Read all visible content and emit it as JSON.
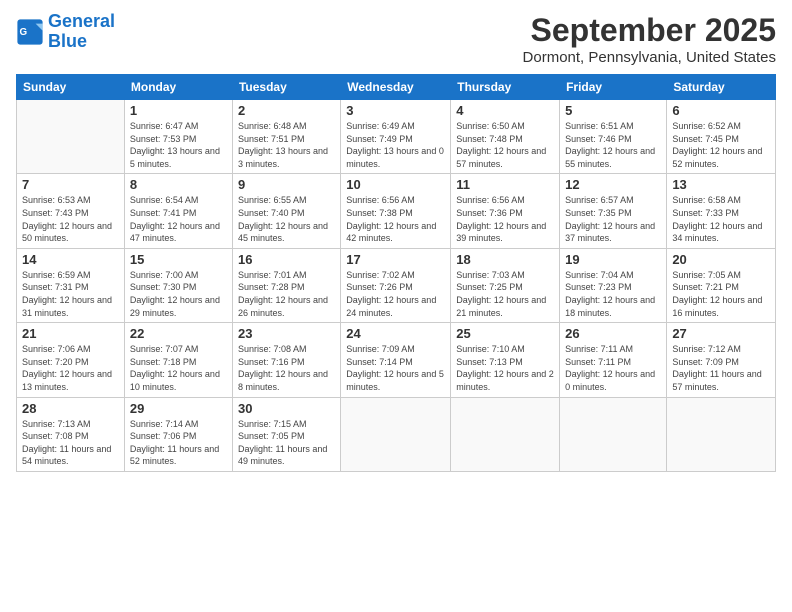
{
  "logo": {
    "line1": "General",
    "line2": "Blue"
  },
  "title": "September 2025",
  "subtitle": "Dormont, Pennsylvania, United States",
  "days_of_week": [
    "Sunday",
    "Monday",
    "Tuesday",
    "Wednesday",
    "Thursday",
    "Friday",
    "Saturday"
  ],
  "weeks": [
    [
      {
        "num": "",
        "sunrise": "",
        "sunset": "",
        "daylight": ""
      },
      {
        "num": "1",
        "sunrise": "Sunrise: 6:47 AM",
        "sunset": "Sunset: 7:53 PM",
        "daylight": "Daylight: 13 hours and 5 minutes."
      },
      {
        "num": "2",
        "sunrise": "Sunrise: 6:48 AM",
        "sunset": "Sunset: 7:51 PM",
        "daylight": "Daylight: 13 hours and 3 minutes."
      },
      {
        "num": "3",
        "sunrise": "Sunrise: 6:49 AM",
        "sunset": "Sunset: 7:49 PM",
        "daylight": "Daylight: 13 hours and 0 minutes."
      },
      {
        "num": "4",
        "sunrise": "Sunrise: 6:50 AM",
        "sunset": "Sunset: 7:48 PM",
        "daylight": "Daylight: 12 hours and 57 minutes."
      },
      {
        "num": "5",
        "sunrise": "Sunrise: 6:51 AM",
        "sunset": "Sunset: 7:46 PM",
        "daylight": "Daylight: 12 hours and 55 minutes."
      },
      {
        "num": "6",
        "sunrise": "Sunrise: 6:52 AM",
        "sunset": "Sunset: 7:45 PM",
        "daylight": "Daylight: 12 hours and 52 minutes."
      }
    ],
    [
      {
        "num": "7",
        "sunrise": "Sunrise: 6:53 AM",
        "sunset": "Sunset: 7:43 PM",
        "daylight": "Daylight: 12 hours and 50 minutes."
      },
      {
        "num": "8",
        "sunrise": "Sunrise: 6:54 AM",
        "sunset": "Sunset: 7:41 PM",
        "daylight": "Daylight: 12 hours and 47 minutes."
      },
      {
        "num": "9",
        "sunrise": "Sunrise: 6:55 AM",
        "sunset": "Sunset: 7:40 PM",
        "daylight": "Daylight: 12 hours and 45 minutes."
      },
      {
        "num": "10",
        "sunrise": "Sunrise: 6:56 AM",
        "sunset": "Sunset: 7:38 PM",
        "daylight": "Daylight: 12 hours and 42 minutes."
      },
      {
        "num": "11",
        "sunrise": "Sunrise: 6:56 AM",
        "sunset": "Sunset: 7:36 PM",
        "daylight": "Daylight: 12 hours and 39 minutes."
      },
      {
        "num": "12",
        "sunrise": "Sunrise: 6:57 AM",
        "sunset": "Sunset: 7:35 PM",
        "daylight": "Daylight: 12 hours and 37 minutes."
      },
      {
        "num": "13",
        "sunrise": "Sunrise: 6:58 AM",
        "sunset": "Sunset: 7:33 PM",
        "daylight": "Daylight: 12 hours and 34 minutes."
      }
    ],
    [
      {
        "num": "14",
        "sunrise": "Sunrise: 6:59 AM",
        "sunset": "Sunset: 7:31 PM",
        "daylight": "Daylight: 12 hours and 31 minutes."
      },
      {
        "num": "15",
        "sunrise": "Sunrise: 7:00 AM",
        "sunset": "Sunset: 7:30 PM",
        "daylight": "Daylight: 12 hours and 29 minutes."
      },
      {
        "num": "16",
        "sunrise": "Sunrise: 7:01 AM",
        "sunset": "Sunset: 7:28 PM",
        "daylight": "Daylight: 12 hours and 26 minutes."
      },
      {
        "num": "17",
        "sunrise": "Sunrise: 7:02 AM",
        "sunset": "Sunset: 7:26 PM",
        "daylight": "Daylight: 12 hours and 24 minutes."
      },
      {
        "num": "18",
        "sunrise": "Sunrise: 7:03 AM",
        "sunset": "Sunset: 7:25 PM",
        "daylight": "Daylight: 12 hours and 21 minutes."
      },
      {
        "num": "19",
        "sunrise": "Sunrise: 7:04 AM",
        "sunset": "Sunset: 7:23 PM",
        "daylight": "Daylight: 12 hours and 18 minutes."
      },
      {
        "num": "20",
        "sunrise": "Sunrise: 7:05 AM",
        "sunset": "Sunset: 7:21 PM",
        "daylight": "Daylight: 12 hours and 16 minutes."
      }
    ],
    [
      {
        "num": "21",
        "sunrise": "Sunrise: 7:06 AM",
        "sunset": "Sunset: 7:20 PM",
        "daylight": "Daylight: 12 hours and 13 minutes."
      },
      {
        "num": "22",
        "sunrise": "Sunrise: 7:07 AM",
        "sunset": "Sunset: 7:18 PM",
        "daylight": "Daylight: 12 hours and 10 minutes."
      },
      {
        "num": "23",
        "sunrise": "Sunrise: 7:08 AM",
        "sunset": "Sunset: 7:16 PM",
        "daylight": "Daylight: 12 hours and 8 minutes."
      },
      {
        "num": "24",
        "sunrise": "Sunrise: 7:09 AM",
        "sunset": "Sunset: 7:14 PM",
        "daylight": "Daylight: 12 hours and 5 minutes."
      },
      {
        "num": "25",
        "sunrise": "Sunrise: 7:10 AM",
        "sunset": "Sunset: 7:13 PM",
        "daylight": "Daylight: 12 hours and 2 minutes."
      },
      {
        "num": "26",
        "sunrise": "Sunrise: 7:11 AM",
        "sunset": "Sunset: 7:11 PM",
        "daylight": "Daylight: 12 hours and 0 minutes."
      },
      {
        "num": "27",
        "sunrise": "Sunrise: 7:12 AM",
        "sunset": "Sunset: 7:09 PM",
        "daylight": "Daylight: 11 hours and 57 minutes."
      }
    ],
    [
      {
        "num": "28",
        "sunrise": "Sunrise: 7:13 AM",
        "sunset": "Sunset: 7:08 PM",
        "daylight": "Daylight: 11 hours and 54 minutes."
      },
      {
        "num": "29",
        "sunrise": "Sunrise: 7:14 AM",
        "sunset": "Sunset: 7:06 PM",
        "daylight": "Daylight: 11 hours and 52 minutes."
      },
      {
        "num": "30",
        "sunrise": "Sunrise: 7:15 AM",
        "sunset": "Sunset: 7:05 PM",
        "daylight": "Daylight: 11 hours and 49 minutes."
      },
      {
        "num": "",
        "sunrise": "",
        "sunset": "",
        "daylight": ""
      },
      {
        "num": "",
        "sunrise": "",
        "sunset": "",
        "daylight": ""
      },
      {
        "num": "",
        "sunrise": "",
        "sunset": "",
        "daylight": ""
      },
      {
        "num": "",
        "sunrise": "",
        "sunset": "",
        "daylight": ""
      }
    ]
  ]
}
